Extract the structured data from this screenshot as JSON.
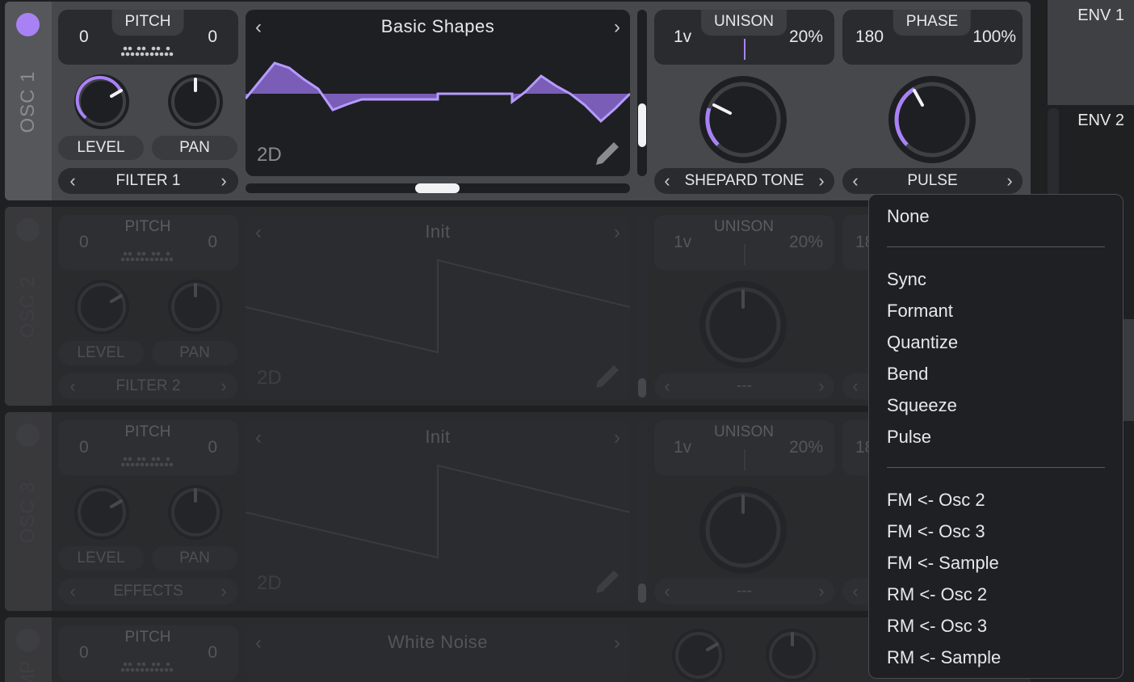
{
  "colors": {
    "accent": "#a882f5",
    "panel": "#47484b",
    "dark": "#1f2022"
  },
  "osc1": {
    "label": "OSC 1",
    "pitch_title": "PITCH",
    "pitch_left": "0",
    "pitch_right": "0",
    "level": "LEVEL",
    "pan": "PAN",
    "filter": "FILTER 1",
    "wave_title": "Basic Shapes",
    "wave_dim": "2D",
    "unison_title": "UNISON",
    "unison_voices": "1v",
    "unison_detune": "20%",
    "phase_title": "PHASE",
    "phase_left": "180",
    "phase_right": "100%",
    "spectral_mode": "SHEPARD TONE",
    "distortion_mode": "PULSE"
  },
  "osc2": {
    "label": "OSC 2",
    "pitch_title": "PITCH",
    "pitch_left": "0",
    "pitch_right": "0",
    "level": "LEVEL",
    "pan": "PAN",
    "filter": "FILTER 2",
    "wave_title": "Init",
    "wave_dim": "2D",
    "unison_title": "UNISON",
    "unison_voices": "1v",
    "unison_detune": "20%",
    "phase_left": "18",
    "spectral_mode": "---"
  },
  "osc3": {
    "label": "OSC 3",
    "pitch_title": "PITCH",
    "pitch_left": "0",
    "pitch_right": "0",
    "level": "LEVEL",
    "pan": "PAN",
    "filter": "EFFECTS",
    "wave_title": "Init",
    "wave_dim": "2D",
    "unison_title": "UNISON",
    "unison_voices": "1v",
    "unison_detune": "20%",
    "phase_left": "18",
    "spectral_mode": "---"
  },
  "smp": {
    "label": "SMP",
    "pitch_title": "PITCH",
    "pitch_left": "0",
    "pitch_right": "0",
    "wave_title": "White Noise"
  },
  "env": {
    "env1": "ENV 1",
    "env2": "ENV 2"
  },
  "menu": {
    "group1": [
      "None"
    ],
    "group2": [
      "Sync",
      "Formant",
      "Quantize",
      "Bend",
      "Squeeze",
      "Pulse"
    ],
    "group3": [
      "FM <- Osc 2",
      "FM <- Osc 3",
      "FM <- Sample",
      "RM <- Osc 2",
      "RM <- Osc 3",
      "RM <- Sample"
    ]
  }
}
